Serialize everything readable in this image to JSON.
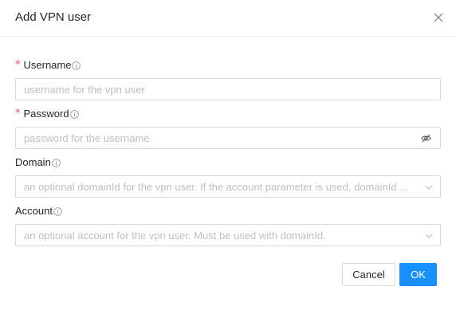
{
  "modal": {
    "title": "Add VPN user",
    "close_icon": "close-icon"
  },
  "form": {
    "username": {
      "label": "Username",
      "required_mark": "*",
      "placeholder": "username for the vpn user"
    },
    "password": {
      "label": "Password",
      "required_mark": "*",
      "placeholder": "password for the username",
      "toggle_icon": "eye-invisible-icon"
    },
    "domain": {
      "label": "Domain",
      "placeholder": "an optional domainId for the vpn user. If the account parameter is used, domainId ..."
    },
    "account": {
      "label": "Account",
      "placeholder": "an optional account for the vpn user. Must be used with domainId."
    }
  },
  "footer": {
    "cancel_label": "Cancel",
    "ok_label": "OK"
  },
  "colors": {
    "required": "#ff4d4f",
    "primary": "#1890ff",
    "border": "#d9d9d9",
    "placeholder": "#bfbfbf"
  }
}
